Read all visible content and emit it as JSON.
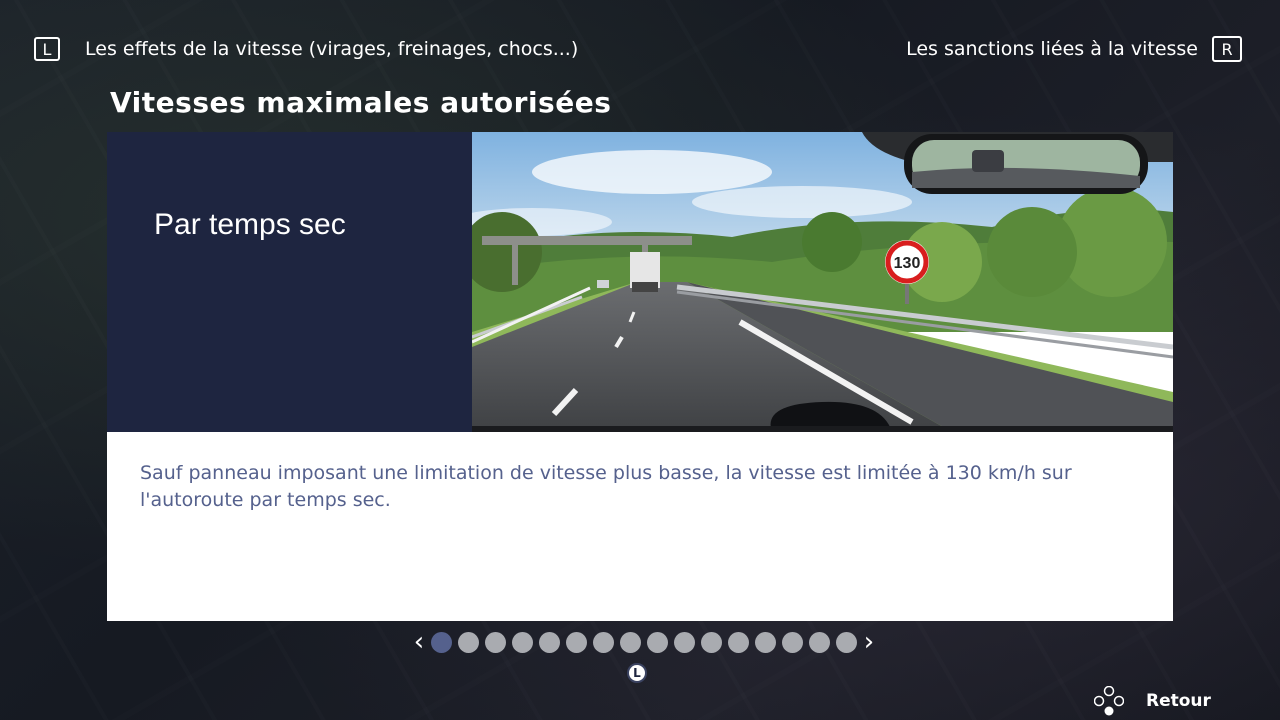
{
  "nav": {
    "prev_key": "L",
    "prev_label": "Les effets de la vitesse (virages, freinages, chocs...)",
    "next_label": "Les sanctions liées à la vitesse",
    "next_key": "R"
  },
  "title": "Vitesses maximales autorisées",
  "card": {
    "heading": "Par temps sec",
    "photo_sign": "130",
    "text": "Sauf panneau imposant une limitation de vitesse plus basse, la vitesse est limitée à 130 km/h sur l'autoroute par temps sec."
  },
  "pager": {
    "total": 16,
    "current": 1,
    "indicator_key": "L"
  },
  "footer": {
    "back_label": "Retour"
  },
  "colors": {
    "panel": "#1e2540",
    "text_accent": "#55618d",
    "dot_inactive": "#a9abb0",
    "dot_active": "#55618d"
  }
}
